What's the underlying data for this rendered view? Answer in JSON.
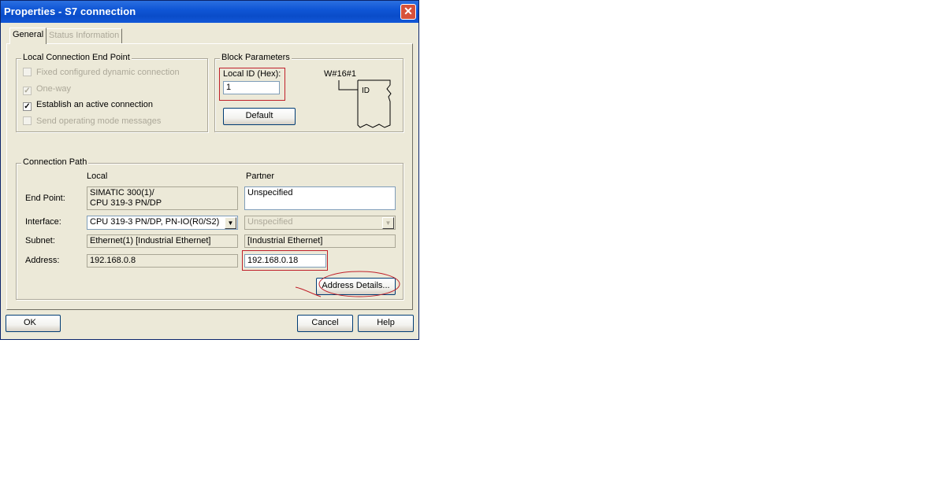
{
  "window": {
    "title": "Properties - S7 connection",
    "close_glyph": "✕"
  },
  "tabs": [
    {
      "label": "General",
      "active": true
    },
    {
      "label": "Status Information",
      "active": false
    }
  ],
  "local_endpoint": {
    "title": "Local Connection End Point",
    "options": [
      {
        "label": "Fixed configured dynamic connection",
        "checked": false,
        "enabled": false
      },
      {
        "label": "One-way",
        "checked": true,
        "enabled": false
      },
      {
        "label": "Establish an active connection",
        "checked": true,
        "enabled": true
      },
      {
        "label": "Send operating mode messages",
        "checked": false,
        "enabled": false
      }
    ]
  },
  "block_params": {
    "title": "Block Parameters",
    "local_id_label": "Local ID (Hex):",
    "local_id_value": "1",
    "default_button": "Default",
    "block_value": "W#16#1",
    "block_pin": "ID"
  },
  "connection_path": {
    "title": "Connection Path",
    "col_local": "Local",
    "col_partner": "Partner",
    "end_point_label": "End Point:",
    "local_end_point_line1": "SIMATIC 300(1)/",
    "local_end_point_line2": "CPU 319-3 PN/DP",
    "partner_end_point": "Unspecified",
    "interface_label": "Interface:",
    "local_interface": "CPU 319-3 PN/DP, PN-IO(R0/S2)",
    "partner_interface": "Unspecified",
    "subnet_label": "Subnet:",
    "local_subnet": "Ethernet(1) [Industrial Ethernet]",
    "partner_subnet": "[Industrial Ethernet]",
    "address_label": "Address:",
    "local_address": "192.168.0.8",
    "partner_address": "192.168.0.18",
    "address_details_button": "Address Details..."
  },
  "footer": {
    "ok": "OK",
    "cancel": "Cancel",
    "help": "Help"
  },
  "colors": {
    "title_bar": "#0a4cc9",
    "annotation": "#c0202a"
  }
}
